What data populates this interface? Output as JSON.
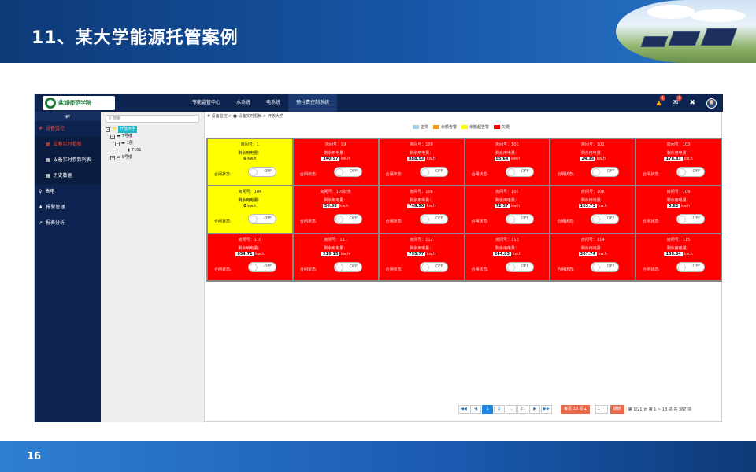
{
  "slide": {
    "title": "11、某大学能源托管案例",
    "page_number": "16"
  },
  "app": {
    "logo_text": "盐城师范学院",
    "topnav": [
      "节能监管中心",
      "水系统",
      "电系统",
      "预付费控制系统"
    ],
    "badges": [
      "1",
      "0"
    ],
    "sidebar": {
      "toggle": "⇄",
      "items": [
        {
          "icon": "#",
          "label": "设备监控"
        },
        {
          "icon": "♀",
          "label": "售电"
        },
        {
          "icon": "♟",
          "label": "报警管理"
        },
        {
          "icon": "↗",
          "label": "报表分析"
        }
      ],
      "subitems": [
        {
          "icon": "▦",
          "label": "设备实时看板"
        },
        {
          "icon": "▦",
          "label": "设备实时参数列表"
        },
        {
          "icon": "▦",
          "label": "历史数据"
        }
      ]
    },
    "tree": {
      "search_placeholder": "搜索",
      "nodes": [
        {
          "exp": "−",
          "label": "开放大学",
          "indent": 0
        },
        {
          "exp": "−",
          "label": "7号楼",
          "indent": 1
        },
        {
          "exp": "−",
          "label": "1层",
          "indent": 2
        },
        {
          "exp": "",
          "label": "7101",
          "indent": 3
        },
        {
          "exp": "+",
          "label": "9号楼",
          "indent": 1
        }
      ]
    },
    "breadcrumb": "# 设备监控 > ■ 设备实时看板 > 开放大学",
    "legend": [
      {
        "label": "正常",
        "color": "#9fd3f0"
      },
      {
        "label": "余额告警",
        "color": "#f39c12"
      },
      {
        "label": "余额超告警",
        "color": "#ffff00"
      },
      {
        "label": "欠费",
        "color": "#ff0000"
      }
    ],
    "cards": [
      {
        "room": "房间号：1",
        "balance": "0",
        "status": "yellow"
      },
      {
        "room": "房间号：99",
        "balance": "340.57",
        "status": "red"
      },
      {
        "room": "房间号：100",
        "balance": "888.53",
        "status": "red"
      },
      {
        "room": "房间号：101",
        "balance": "55.64",
        "status": "red"
      },
      {
        "room": "房间号：102",
        "balance": "24.35",
        "status": "red"
      },
      {
        "room": "房间号：103",
        "balance": "178.83",
        "status": "red"
      },
      {
        "room": "房间号：104",
        "balance": "0",
        "status": "yellow"
      },
      {
        "room": "房间号：105财务",
        "balance": "56.58",
        "status": "red"
      },
      {
        "room": "房间号：106",
        "balance": "748.50",
        "status": "red"
      },
      {
        "room": "房间号：107",
        "balance": "72.57",
        "status": "red"
      },
      {
        "room": "房间号：108",
        "balance": "165.73",
        "status": "red"
      },
      {
        "room": "房间号：109",
        "balance": "0.63",
        "status": "red"
      },
      {
        "room": "房间号：110",
        "balance": "634.71",
        "status": "red"
      },
      {
        "room": "房间号：111",
        "balance": "219.15",
        "status": "red"
      },
      {
        "room": "房间号：112",
        "balance": "795.77",
        "status": "red"
      },
      {
        "room": "房间号：113",
        "balance": "244.83",
        "status": "red"
      },
      {
        "room": "房间号：114",
        "balance": "307.74",
        "status": "red"
      },
      {
        "room": "房间号：115",
        "balance": "130.34",
        "status": "red"
      }
    ],
    "card_labels": {
      "balance_label": "剩余用电量：",
      "unit": "kw.h",
      "gate_label": "合闸状态:",
      "switch_state": "OFF"
    },
    "pager": {
      "buttons": [
        "◀◀",
        "◀",
        "1",
        "2",
        "…",
        "21",
        "▶",
        "▶▶"
      ],
      "active": "1",
      "page_size": "每页 18 项 ▴",
      "page_input": "1",
      "go": "跳转",
      "info": "第 1/21 页  第 1 ~ 18 项  共 367 项"
    }
  }
}
